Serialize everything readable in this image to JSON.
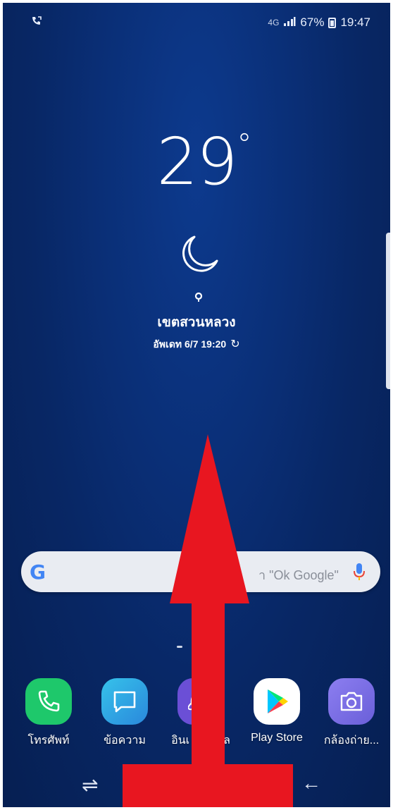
{
  "status_bar": {
    "left_icon": "call-forward-icon",
    "network": "4G",
    "signal": "signal-bars-icon",
    "battery": "67%",
    "time": "19:47"
  },
  "weather": {
    "temperature": "29",
    "degree": "°",
    "condition_icon": "crescent-moon-icon",
    "location": "เขตสวนหลวง",
    "updated": "อัพเดท 6/7 19:20"
  },
  "search": {
    "logo": "G",
    "hint": "า \"Ok Google\""
  },
  "dock": [
    {
      "label": "โทรศัพท์",
      "icon": "phone-icon",
      "color": "#1ec86b"
    },
    {
      "label": "ข้อความ",
      "icon": "message-icon",
      "color": "#2ea6e6"
    },
    {
      "label": "อินเ",
      "label2": "ล",
      "icon": "internet-icon",
      "color": "#6b4fd6"
    },
    {
      "label": "Play Store",
      "icon": "play-store-icon",
      "color": "#ffffff"
    },
    {
      "label": "กล้องถ่าย...",
      "icon": "camera-icon",
      "color": "#7a6fe6"
    }
  ],
  "navbar": {
    "recent": "⇌",
    "back": "←"
  },
  "overlay": {
    "arrow_color": "#e81620",
    "direction": "up"
  }
}
